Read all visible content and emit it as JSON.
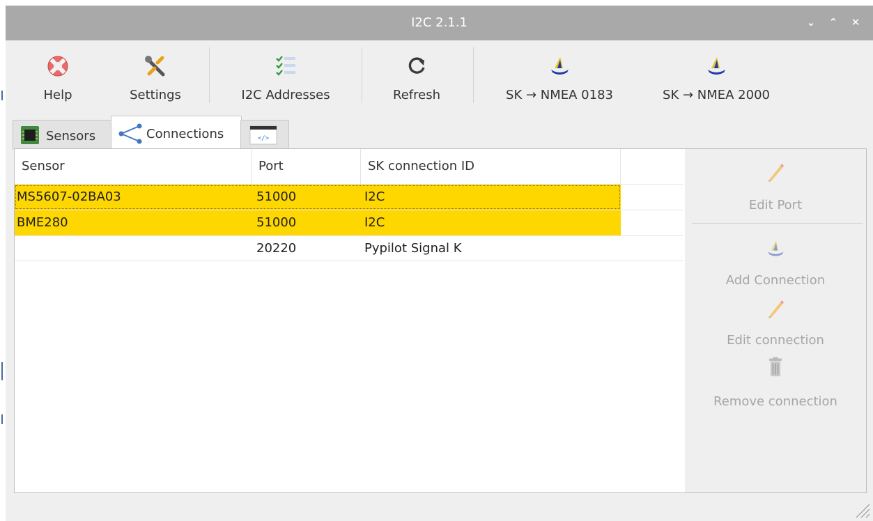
{
  "window": {
    "title": "I2C 2.1.1",
    "controls": [
      "⌄",
      "⌃",
      "✕"
    ]
  },
  "toolbar": {
    "help": "Help",
    "settings": "Settings",
    "addresses": "I2C Addresses",
    "refresh": "Refresh",
    "nmea0183": "SK → NMEA 0183",
    "nmea2000": "SK → NMEA 2000"
  },
  "tabs": {
    "sensors": "Sensors",
    "connections": "Connections"
  },
  "table": {
    "columns": [
      "Sensor",
      "Port",
      "SK connection ID"
    ],
    "rows": [
      {
        "sensor": "MS5607-02BA03",
        "port": "51000",
        "id": "I2C"
      },
      {
        "sensor": "BME280",
        "port": "51000",
        "id": "I2C"
      },
      {
        "sensor": "",
        "port": "20220",
        "id": "Pypilot Signal K"
      }
    ]
  },
  "side": {
    "edit_port": "Edit Port",
    "add_connection": "Add Connection",
    "edit_connection": "Edit connection",
    "remove_connection": "Remove connection"
  },
  "colors": {
    "selection": "#ffd700",
    "titlebar": "#a9a9a9",
    "background": "#efefef",
    "disabled_text": "#a6a6a6"
  },
  "icons": [
    "lifebuoy-icon",
    "wrench-screwdriver-icon",
    "checklist-icon",
    "refresh-icon",
    "signalk-sailboat-icon",
    "chip-icon",
    "share-nodes-icon",
    "code-window-icon",
    "pencil-icon",
    "trash-icon",
    "resize-grip-icon"
  ]
}
